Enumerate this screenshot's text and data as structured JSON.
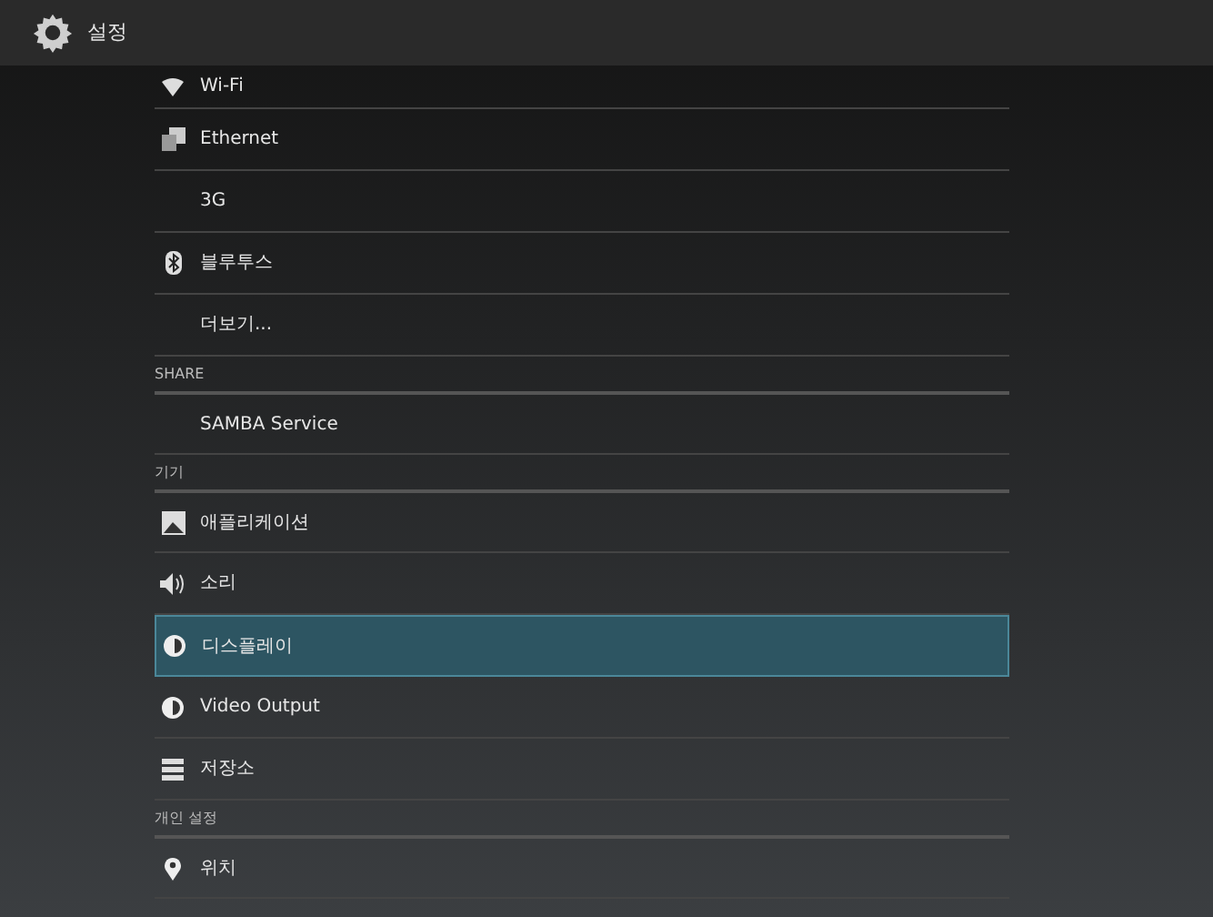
{
  "header": {
    "title": "설정"
  },
  "list": [
    {
      "kind": "item",
      "label": "Wi-Fi",
      "selected": false
    },
    {
      "kind": "item",
      "label": "Ethernet",
      "selected": false
    },
    {
      "kind": "item",
      "label": "3G",
      "selected": false
    },
    {
      "kind": "item",
      "label": "블루투스",
      "selected": false
    },
    {
      "kind": "item",
      "label": "더보기...",
      "selected": false
    },
    {
      "kind": "section",
      "label": "SHARE"
    },
    {
      "kind": "item",
      "label": "SAMBA Service",
      "selected": false
    },
    {
      "kind": "section",
      "label": "기기"
    },
    {
      "kind": "item",
      "label": "애플리케이션",
      "selected": false
    },
    {
      "kind": "item",
      "label": "소리",
      "selected": false
    },
    {
      "kind": "item",
      "label": "디스플레이",
      "selected": true
    },
    {
      "kind": "item",
      "label": "Video Output",
      "selected": false
    },
    {
      "kind": "item",
      "label": "저장소",
      "selected": false
    },
    {
      "kind": "section",
      "label": "개인 설정"
    },
    {
      "kind": "item",
      "label": "위치",
      "selected": false
    }
  ]
}
